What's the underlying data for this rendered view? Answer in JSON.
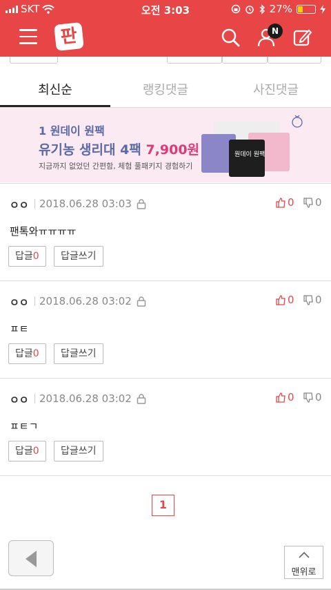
{
  "status": {
    "carrier": "SKT",
    "time": "오전 3:03",
    "battery": "27%"
  },
  "header": {
    "logo": "판",
    "badge": "N"
  },
  "tabs": [
    "최신순",
    "랭킹댓글",
    "사진댓글"
  ],
  "ad": {
    "line1": "1 원데이 원팩",
    "line2_a": "유기농 생리대 4팩 ",
    "line2_b": "7,900원",
    "line3": "지금까지 없었던 간편함, 체험 풀패키지 경험하기",
    "pack_label": "원데이 원팩"
  },
  "comments": [
    {
      "user": "ㅇㅇ",
      "date": "2018.06.28 03:03",
      "likes": "0",
      "dislikes": "0",
      "text": "팬톡와ㅠㅠㅠㅠ",
      "reply_label": "답글",
      "reply_count": "0",
      "write_reply": "답글쓰기"
    },
    {
      "user": "ㅇㅇ",
      "date": "2018.06.28 03:02",
      "likes": "0",
      "dislikes": "0",
      "text": "ㅍㅌ",
      "reply_label": "답글",
      "reply_count": "0",
      "write_reply": "답글쓰기"
    },
    {
      "user": "ㅇㅇ",
      "date": "2018.06.28 03:02",
      "likes": "0",
      "dislikes": "0",
      "text": "ㅍㅌㄱ",
      "reply_label": "답글",
      "reply_count": "0",
      "write_reply": "답글쓰기"
    }
  ],
  "pagination": {
    "current": "1"
  },
  "footer": {
    "to_top": "맨위로"
  },
  "colors": {
    "brand": "#e84646",
    "accent": "#e04848"
  }
}
